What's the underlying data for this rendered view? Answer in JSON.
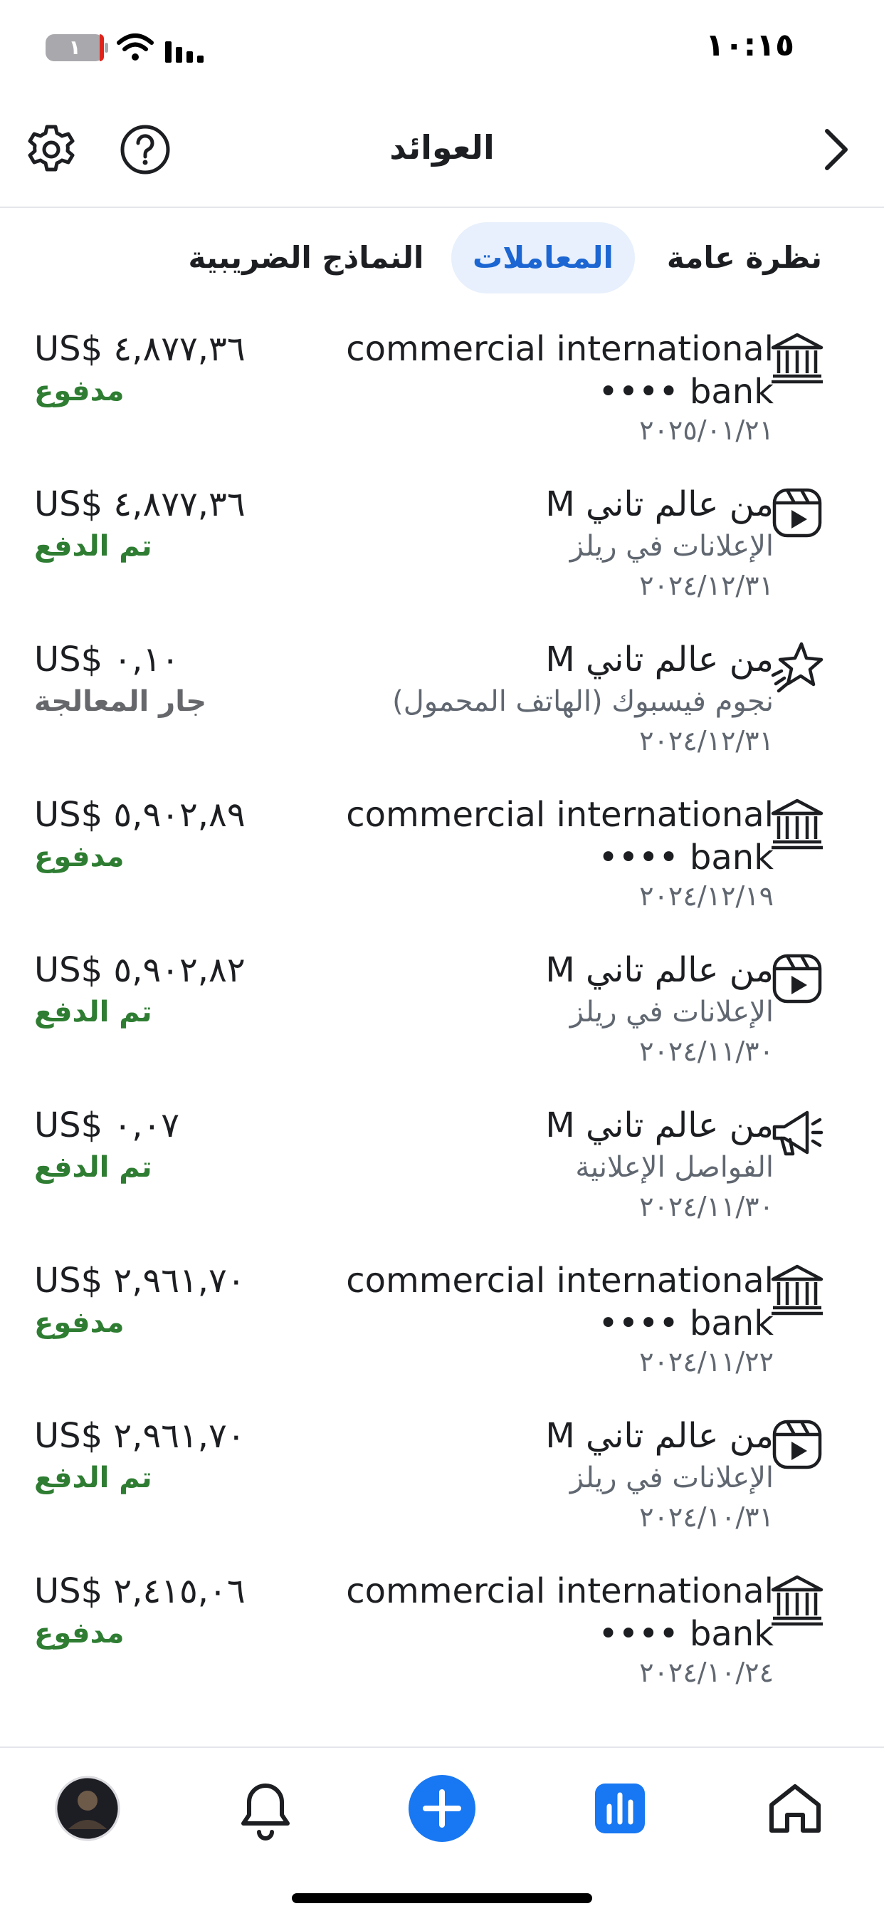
{
  "status_bar": {
    "time": "١٠:١٥",
    "battery_level": "١",
    "icons": [
      "battery-icon",
      "wifi-icon",
      "cellular-signal-icon"
    ]
  },
  "header": {
    "title": "العوائد",
    "icons": [
      "settings-gear-icon",
      "help-question-icon",
      "chevron-right-icon"
    ]
  },
  "tabs": [
    {
      "label": "نظرة عامة",
      "active": false
    },
    {
      "label": "المعاملات",
      "active": true
    },
    {
      "label": "النماذج الضريبية",
      "active": false
    }
  ],
  "transactions": [
    {
      "icon": "bank-icon",
      "title": "commercial international bank ••••",
      "subtitle": "",
      "date": "٢٠٢٥/٠١/٢١",
      "amount": "US$ ٤,٨٧٧,٣٦",
      "status": "مدفوع",
      "status_type": "paid"
    },
    {
      "icon": "reels-video-icon",
      "title": "من عالم تاني M",
      "subtitle": "الإعلانات في ريلز",
      "date": "٢٠٢٤/١٢/٣١",
      "amount": "US$ ٤,٨٧٧,٣٦",
      "status": "تم الدفع",
      "status_type": "paid"
    },
    {
      "icon": "stars-icon",
      "title": "من عالم تاني M",
      "subtitle": "نجوم فيسبوك (الهاتف المحمول)",
      "date": "٢٠٢٤/١٢/٣١",
      "amount": "US$ ٠,١٠",
      "status": "جار المعالجة",
      "status_type": "processing"
    },
    {
      "icon": "bank-icon",
      "title": "commercial international bank ••••",
      "subtitle": "",
      "date": "٢٠٢٤/١٢/١٩",
      "amount": "US$ ٥,٩٠٢,٨٩",
      "status": "مدفوع",
      "status_type": "paid"
    },
    {
      "icon": "reels-video-icon",
      "title": "من عالم تاني M",
      "subtitle": "الإعلانات في ريلز",
      "date": "٢٠٢٤/١١/٣٠",
      "amount": "US$ ٥,٩٠٢,٨٢",
      "status": "تم الدفع",
      "status_type": "paid"
    },
    {
      "icon": "megaphone-icon",
      "title": "من عالم تاني M",
      "subtitle": "الفواصل الإعلانية",
      "date": "٢٠٢٤/١١/٣٠",
      "amount": "US$ ٠,٠٧",
      "status": "تم الدفع",
      "status_type": "paid"
    },
    {
      "icon": "bank-icon",
      "title": "commercial international bank ••••",
      "subtitle": "",
      "date": "٢٠٢٤/١١/٢٢",
      "amount": "US$ ٢,٩٦١,٧٠",
      "status": "مدفوع",
      "status_type": "paid"
    },
    {
      "icon": "reels-video-icon",
      "title": "من عالم تاني M",
      "subtitle": "الإعلانات في ريلز",
      "date": "٢٠٢٤/١٠/٣١",
      "amount": "US$ ٢,٩٦١,٧٠",
      "status": "تم الدفع",
      "status_type": "paid"
    },
    {
      "icon": "bank-icon",
      "title": "commercial international bank ••••",
      "subtitle": "",
      "date": "٢٠٢٤/١٠/٢٤",
      "amount": "US$ ٢,٤١٥,٠٦",
      "status": "مدفوع",
      "status_type": "paid"
    }
  ],
  "bottom_nav": [
    {
      "icon": "profile-avatar-icon",
      "active": false
    },
    {
      "icon": "notifications-bell-icon",
      "active": false
    },
    {
      "icon": "create-plus-icon",
      "active": false
    },
    {
      "icon": "professional-dashboard-icon",
      "active": true
    },
    {
      "icon": "home-icon",
      "active": false
    }
  ],
  "colors": {
    "accent_blue": "#1b66d2",
    "active_tab_bg": "#e7f0fc",
    "paid_green": "#2e7d32",
    "processing_gray": "#65676b",
    "create_button_blue": "#1877f2"
  }
}
